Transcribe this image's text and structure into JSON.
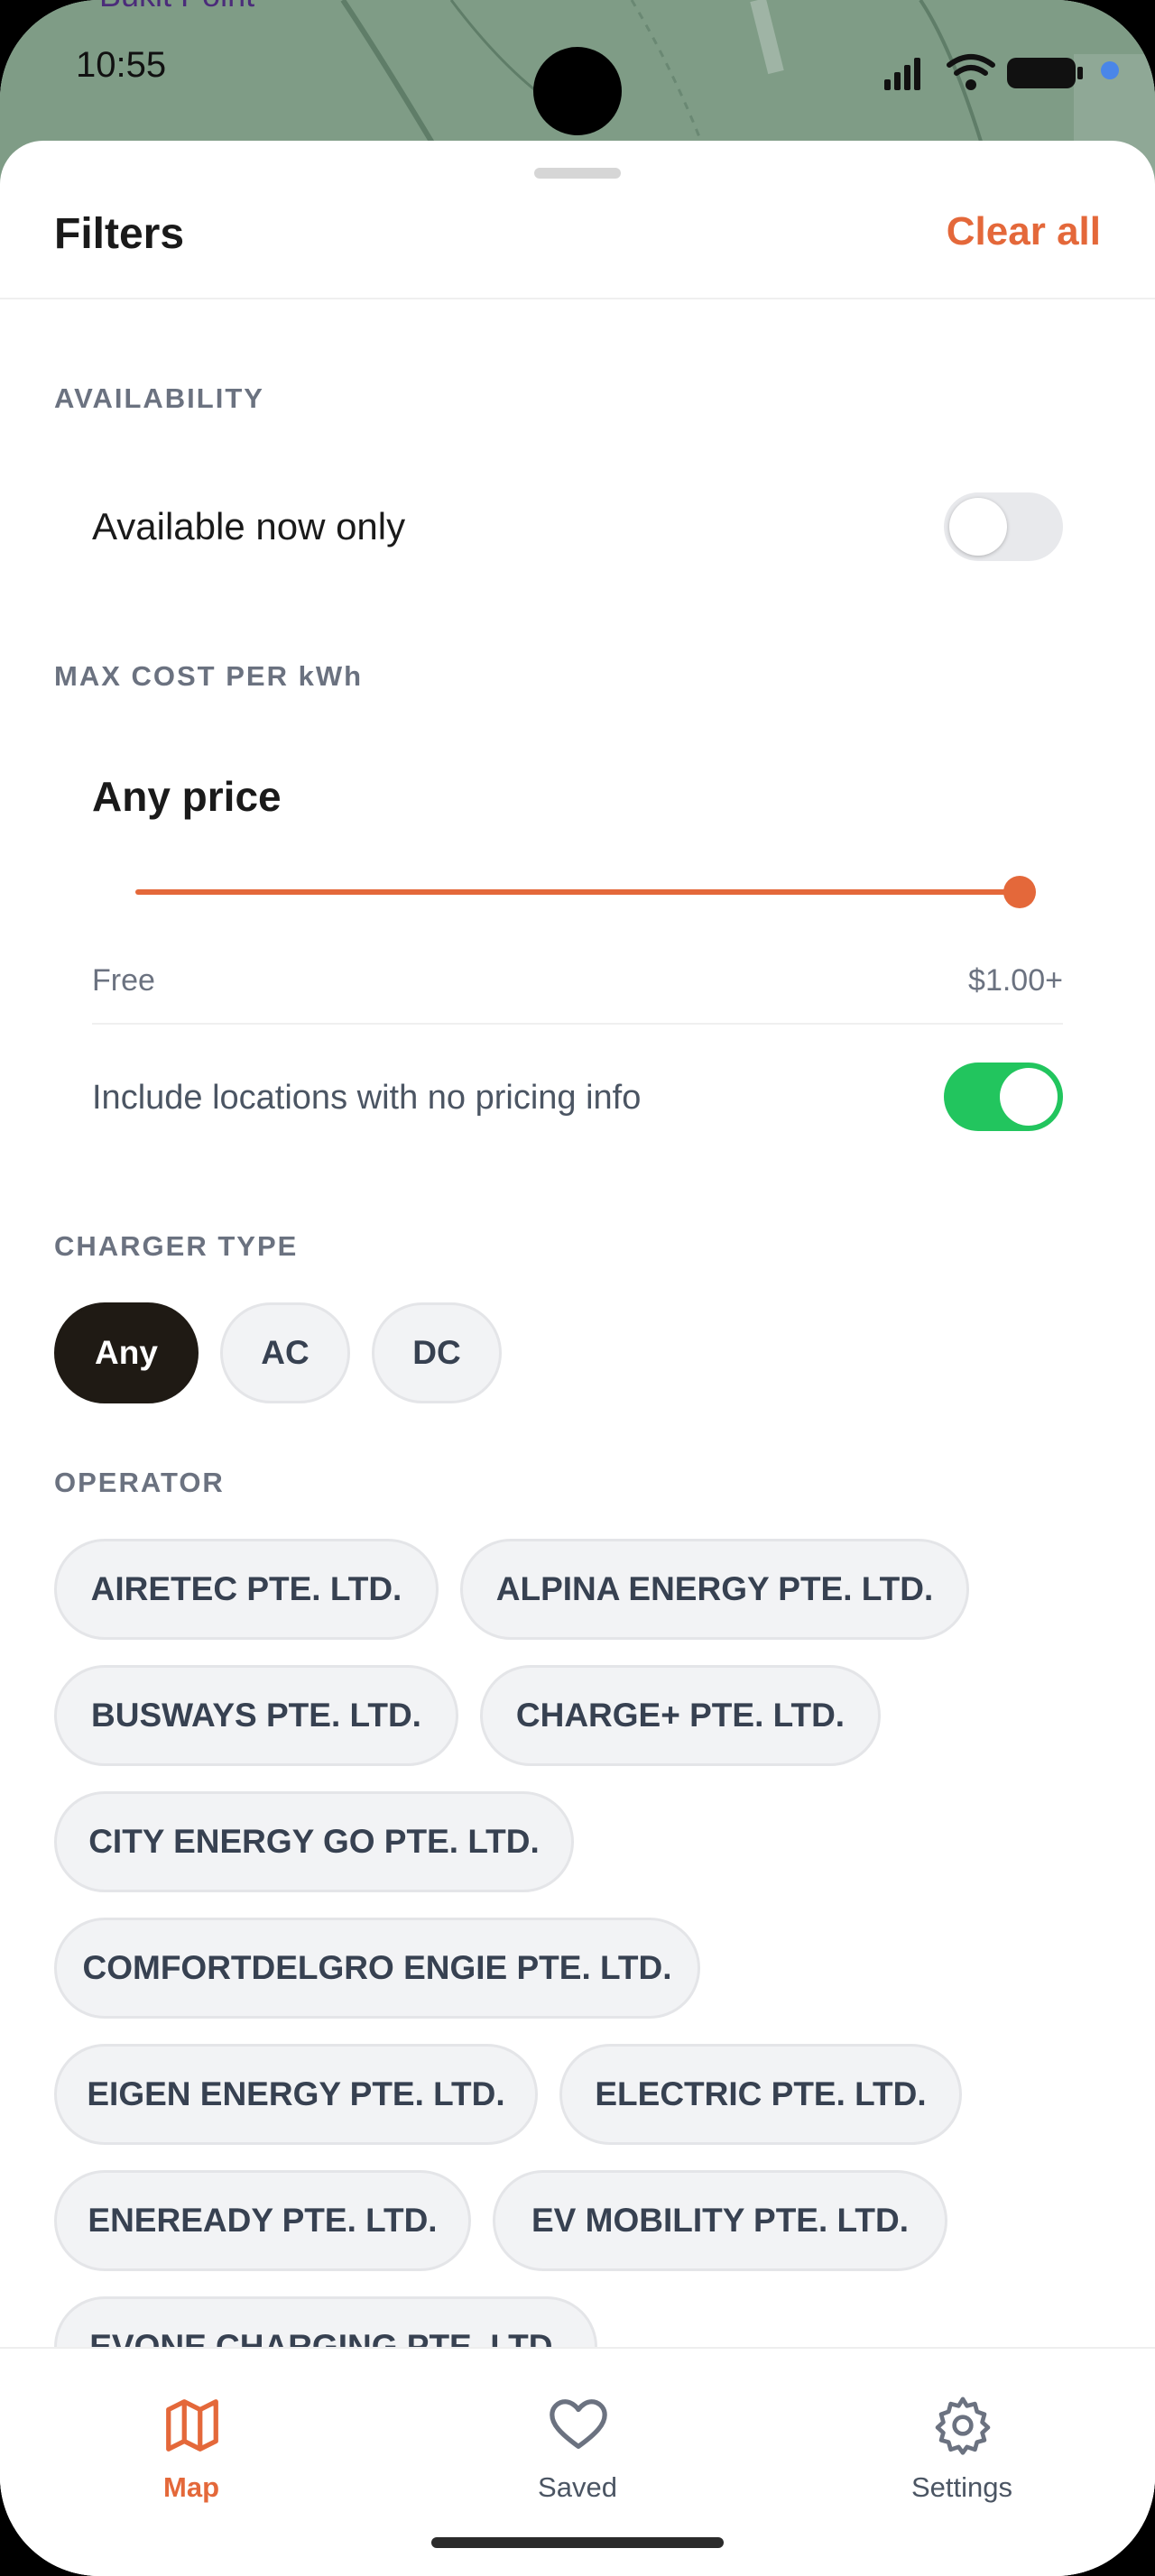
{
  "status_bar": {
    "time": "10:55"
  },
  "map_peek": {
    "label": "Bukit Point"
  },
  "sheet": {
    "title": "Filters",
    "clear_all_label": "Clear all"
  },
  "availability": {
    "section_label": "AVAILABILITY",
    "available_now_label": "Available now only",
    "available_now_enabled": false
  },
  "max_cost": {
    "section_label": "MAX COST PER kWh",
    "value_label": "Any price",
    "slider_value_fraction": 1.0,
    "min_label": "Free",
    "max_label": "$1.00+",
    "include_no_pricing_label": "Include locations with no pricing info",
    "include_no_pricing_enabled": true
  },
  "charger_type": {
    "section_label": "CHARGER TYPE",
    "options": [
      "Any",
      "AC",
      "DC"
    ],
    "selected": "Any"
  },
  "operator": {
    "section_label": "OPERATOR",
    "options": [
      "AIRETEC PTE. LTD.",
      "ALPINA ENERGY PTE. LTD.",
      "BUSWAYS PTE. LTD.",
      "CHARGE+ PTE. LTD.",
      "CITY ENERGY GO PTE. LTD.",
      "COMFORTDELGRO ENGIE PTE. LTD.",
      "EIGEN ENERGY PTE. LTD.",
      "ELECTRIC PTE. LTD.",
      "ENEREADY PTE. LTD.",
      "EV MOBILITY PTE. LTD.",
      "EVONE CHARGING PTE. LTD."
    ]
  },
  "bottom_nav": {
    "items": [
      {
        "label": "Map",
        "icon": "map-icon",
        "active": true
      },
      {
        "label": "Saved",
        "icon": "heart-icon",
        "active": false
      },
      {
        "label": "Settings",
        "icon": "gear-icon",
        "active": false
      }
    ]
  },
  "colors": {
    "accent": "#e4683a",
    "toggle_on": "#22c55e",
    "chip_selected": "#1f1a14",
    "chip_bg": "#f2f3f5",
    "section_label": "#6b7280"
  }
}
